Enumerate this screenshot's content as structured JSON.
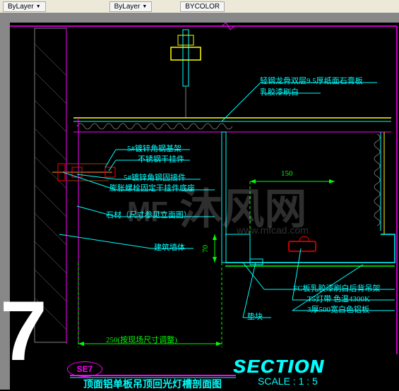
{
  "toolbar": {
    "btn1": "ByLayer",
    "btn2": "ByLayer",
    "btn3": "BYCOLOR"
  },
  "labels": {
    "top_right_1": "轻钢龙骨双层9.5厚纸面石膏板",
    "top_right_2": "乳胶漆刷白",
    "l1": "5#镀锌角钢基架",
    "l2": "不锈钢干挂件",
    "l3": "5#镀锌角钢固接件",
    "l4": "膨胀螺栓固定干挂件底座",
    "l5": "石材（尺寸参见立面图）",
    "l6": "建筑墙体",
    "r1": "FC板乳胶漆刷白后背吊架",
    "r2": "T5灯带 色温4300K",
    "r3": "3厚500宽白色铝板",
    "padblock": "垫块"
  },
  "dims": {
    "d250": "250",
    "d250_note": "(按现场尺寸调整)",
    "d150": "150",
    "d70": "70"
  },
  "title": {
    "tag": "SE7",
    "section": "SECTION",
    "scale": "SCALE : 1 : 5",
    "cn": "顶面铝单板吊顶回光灯槽剖面图"
  },
  "big": "7",
  "watermark": {
    "main": "沐风网",
    "url": "www.mfcad.com"
  },
  "chart_data": {
    "type": "diagram",
    "description": "Architectural section detail SE7: ceiling aluminum panel suspended ceiling with cove light trough",
    "scale": "1:5",
    "dimensions_mm": {
      "horizontal_1": 250,
      "horizontal_2": 150,
      "vertical_1": 70
    },
    "components": [
      "Light-gauge steel keel + double-layer 9.5mm paper-faced gypsum board, white emulsion paint",
      "5# galvanized angle steel base frame",
      "Stainless steel dry-hang clip",
      "5# galvanized angle steel fixing connector",
      "Expansion bolt fixing dry-hang clip base",
      "Stone (size per elevation drawing)",
      "Building structural wall",
      "FC board white emulsion paint with back hanger",
      "T5 light strip, color temperature 4300K",
      "3mm thick 500mm wide white aluminum panel",
      "Spacer block"
    ]
  }
}
